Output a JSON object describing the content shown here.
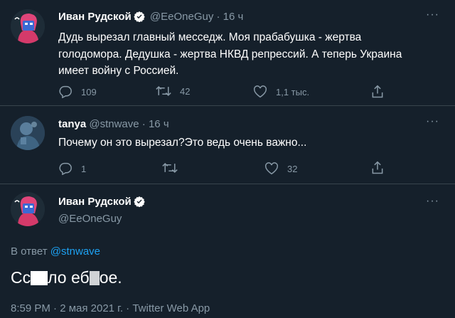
{
  "tweet1": {
    "name": "Иван Рудской",
    "handle": "@EeOneGuy",
    "sep": "·",
    "time": "16 ч",
    "text_lines": [
      "Дудь вырезал главный месседж. Моя прабабушка - жертва",
      "голодомора. Дедушка - жертва НКВД репрессий. А теперь Украина",
      "имеет войну с Россией."
    ],
    "replies": "109",
    "retweets": "42",
    "likes": "1,1 тыс."
  },
  "tweet2": {
    "name": "tanya",
    "handle": "@stnwave",
    "sep": "·",
    "time": "16 ч",
    "text": "Почему он это вырезал?Это ведь очень важно...",
    "replies": "1",
    "retweets": "",
    "likes": "32"
  },
  "tweet3": {
    "name": "Иван Рудской",
    "handle": "@EeOneGuy",
    "reply_prefix": "В ответ",
    "reply_to": "@stnwave",
    "text_part1": "Сс",
    "text_part2": "ло еб",
    "text_part3": "ое.",
    "timestamp": "8:59 PM · 2 мая 2021 г. · Twitter Web App"
  },
  "more_glyph": "···",
  "colors": {
    "background": "#15202b",
    "muted": "#8899a6",
    "link": "#1da1f2",
    "divider": "#38444d",
    "verified": "#ffffff"
  }
}
